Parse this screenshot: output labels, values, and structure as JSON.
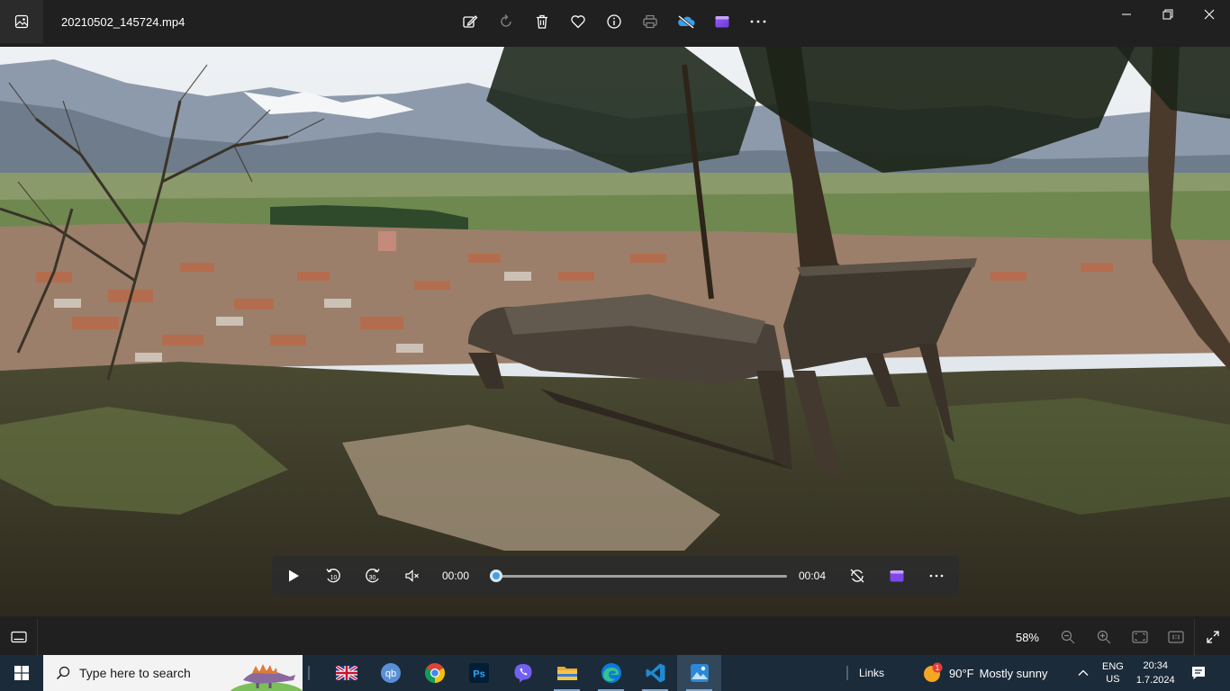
{
  "window": {
    "title": "20210502_145724.mp4"
  },
  "toolbar": {
    "icons": [
      "edit-icon",
      "rotate-icon",
      "delete-icon",
      "favorite-icon",
      "info-icon",
      "print-icon",
      "onedrive-icon",
      "clipchamp-icon",
      "more-icon"
    ]
  },
  "player": {
    "current_time": "00:00",
    "total_time": "00:04",
    "progress": 0.02,
    "rewind_label": "10",
    "forward_label": "30"
  },
  "statusbar": {
    "zoom": "58%"
  },
  "taskbar": {
    "search_placeholder": "Type here to search",
    "links_label": "Links",
    "weather_temp": "90°F",
    "weather_desc": "Mostly sunny",
    "weather_badge": "1",
    "lang_top": "ENG",
    "lang_bottom": "US",
    "time": "20:34",
    "date": "1.7.2024"
  },
  "colors": {
    "accent": "#4a9ee0",
    "taskbar": "#1c2b3a"
  }
}
